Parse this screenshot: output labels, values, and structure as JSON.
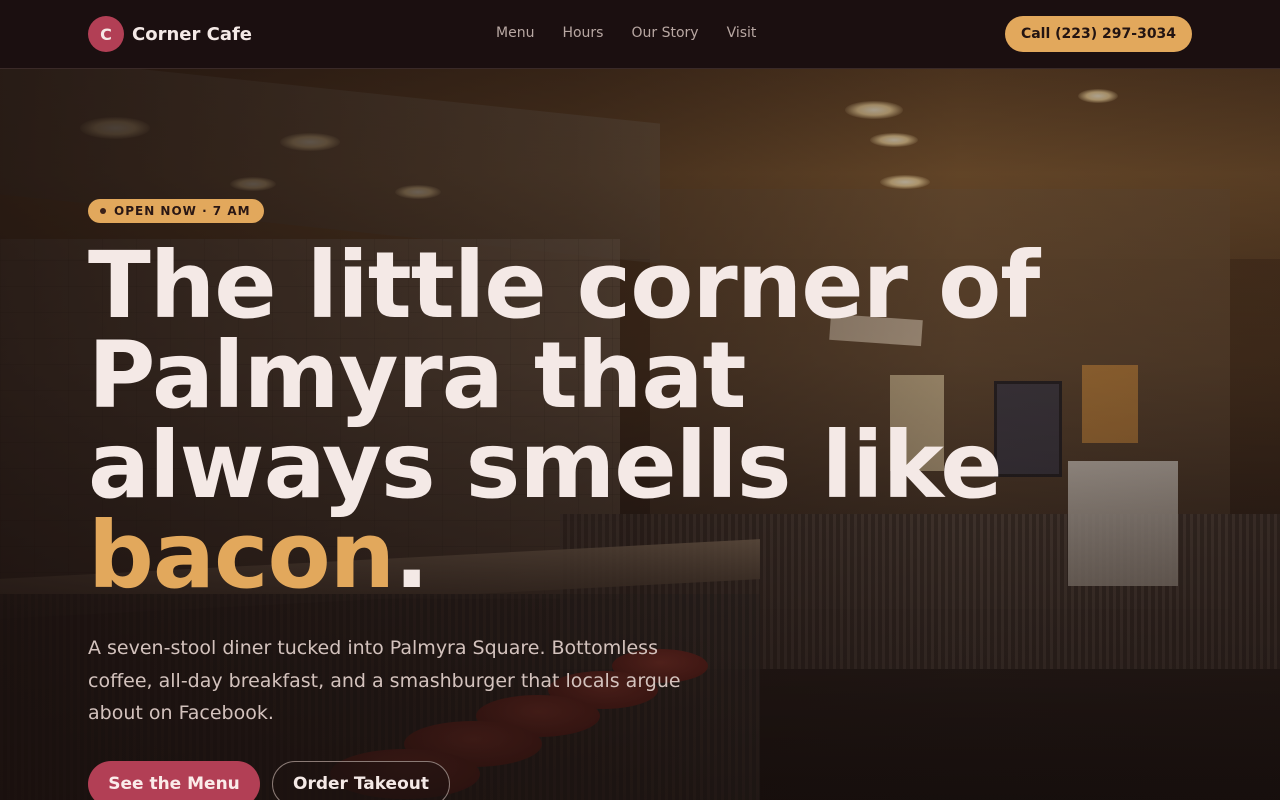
{
  "header": {
    "logo_letter": "C",
    "brand_name": "Corner Cafe",
    "nav": [
      "Menu",
      "Hours",
      "Our Story",
      "Visit"
    ],
    "call_button": "Call (223) 297-3034"
  },
  "hero": {
    "status_badge": "OPEN NOW · 7 AM",
    "headline_main": "The little corner of Palmyra that always smells like",
    "headline_accent": "bacon",
    "headline_end": ".",
    "subcopy": "A seven-stool diner tucked into Palmyra Square. Bottomless coffee, all-day breakfast, and a smashburger that locals argue about on Facebook.",
    "primary_cta": "See the Menu",
    "secondary_cta": "Order Takeout"
  },
  "colors": {
    "brand": "#b23f55",
    "accent": "#e2a85c",
    "header_bg": "#1b0f10",
    "text": "#f4e9e6"
  }
}
